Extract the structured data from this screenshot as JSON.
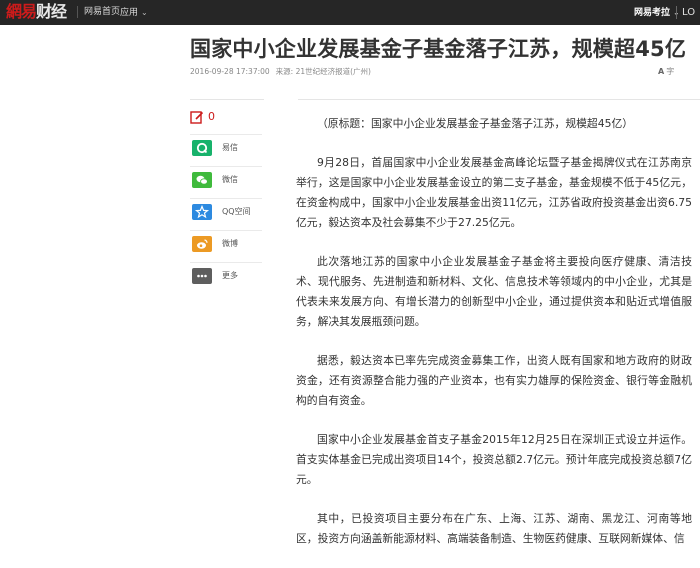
{
  "topbar": {
    "logo_a": "網易",
    "logo_b": "财经",
    "nav_home": "网易首页",
    "nav_apps": "应用",
    "nav_kaola": "网易考拉",
    "nav_login": "LO"
  },
  "article": {
    "title": "国家中小企业发展基金子基金落子江苏，规模超45亿",
    "datetime": "2016-09-28 17:37:00",
    "source": "来源: 21世纪经济报道(广州)",
    "font_size_label": "字",
    "paragraphs": [
      "（原标题：国家中小企业发展基金子基金落子江苏，规模超45亿）",
      "9月28日，首届国家中小企业发展基金高峰论坛暨子基金揭牌仪式在江苏南京举行，这是国家中小企业发展基金设立的第二支子基金，基金规模不低于45亿元，在资金构成中，国家中小企业发展基金出资11亿元，江苏省政府投资基金出资6.75亿元，毅达资本及社会募集不少于27.25亿元。",
      "此次落地江苏的国家中小企业发展基金子基金将主要投向医疗健康、清洁技术、现代服务、先进制造和新材料、文化、信息技术等领域内的中小企业，尤其是代表未来发展方向、有增长潜力的创新型中小企业，通过提供资本和贴近式增值服务，解决其发展瓶颈问题。",
      "据悉，毅达资本已率先完成资金募集工作，出资人既有国家和地方政府的财政资金，还有资源整合能力强的产业资本，也有实力雄厚的保险资金、银行等金融机构的自有资金。",
      "国家中小企业发展基金首支子基金2015年12月25日在深圳正式设立并运作。首支实体基金已完成出资项目14个，投资总额2.7亿元。预计年底完成投资总额7亿元。",
      "其中，已投资项目主要分布在广东、上海、江苏、湖南、黑龙江、河南等地区，投资方向涵盖新能源材料、高端装备制造、生物医药健康、互联网新媒体、信"
    ]
  },
  "sidebar": {
    "comment_count": "0",
    "share": [
      {
        "label": "易信",
        "icon": "yixin-icon",
        "color": "#17b26b"
      },
      {
        "label": "微信",
        "icon": "wechat-icon",
        "color": "#3fba3c"
      },
      {
        "label": "QQ空间",
        "icon": "qzone-icon",
        "color": "#2d8ae0"
      },
      {
        "label": "微博",
        "icon": "weibo-icon",
        "color": "#ec9a24"
      },
      {
        "label": "更多",
        "icon": "more-icon",
        "color": "#5e5e5e"
      }
    ]
  }
}
